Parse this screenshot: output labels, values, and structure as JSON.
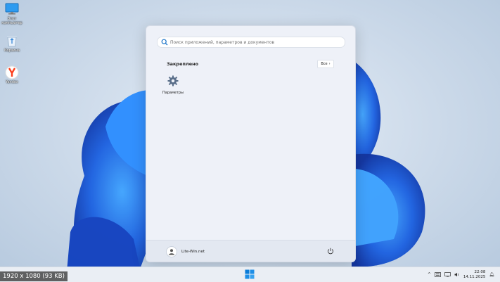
{
  "desktop": {
    "icons": [
      {
        "label": "Этот компьютер",
        "icon": "monitor-icon"
      },
      {
        "label": "Корзина",
        "icon": "recycle-bin-icon"
      },
      {
        "label": "Yandex",
        "icon": "yandex-browser-icon"
      }
    ]
  },
  "start_menu": {
    "search_placeholder": "Поиск приложений, параметров и документов",
    "pinned_title": "Закреплено",
    "all_button": "Все",
    "pinned_apps": [
      {
        "label": "Параметры",
        "icon": "gear-icon"
      }
    ],
    "user_name": "Lite-Win.net"
  },
  "taskbar": {
    "clock_time": "22:08",
    "clock_date": "14.11.2025"
  },
  "overlay": {
    "info": "1920 x 1080 (93 KB)"
  },
  "colors": {
    "accent": "#0067c0",
    "bloom": "#1a5fe0"
  }
}
